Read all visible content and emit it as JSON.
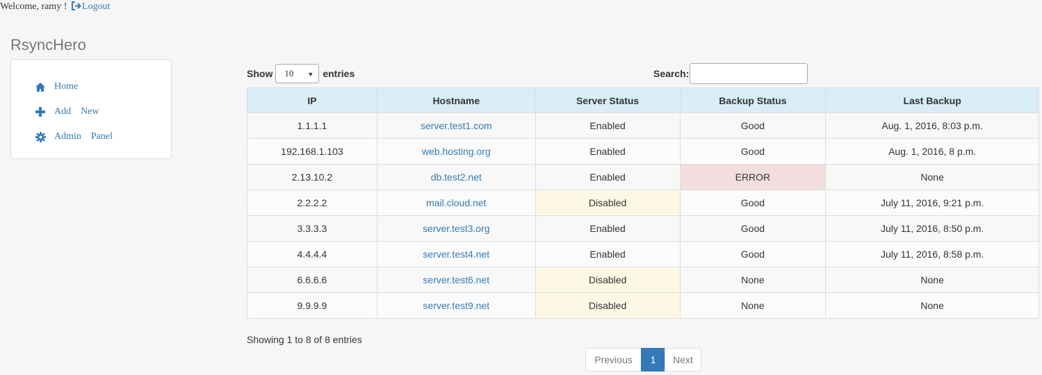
{
  "topbar": {
    "welcome": "Welcome, ramy !",
    "logout_label": "Logout"
  },
  "brand": "RsyncHero",
  "sidebar": {
    "items": [
      {
        "words": [
          "Home"
        ],
        "icon": "home-icon"
      },
      {
        "words": [
          "Add",
          "New"
        ],
        "icon": "plus-icon"
      },
      {
        "words": [
          "Admin",
          "Panel"
        ],
        "icon": "gear-icon"
      }
    ]
  },
  "controls": {
    "show_label": "Show",
    "page_size": "10",
    "entries_label": "entries",
    "search_label": "Search:",
    "search_value": ""
  },
  "table": {
    "headers": [
      "IP",
      "Hostname",
      "Server Status",
      "Backup Status",
      "Last Backup"
    ],
    "rows": [
      {
        "ip": "1.1.1.1",
        "hostname": "server.test1.com",
        "server_status": "Enabled",
        "backup_status": "Good",
        "last_backup": "Aug. 1, 2016, 8:03 p.m."
      },
      {
        "ip": "192.168.1.103",
        "hostname": "web.hosting.org",
        "server_status": "Enabled",
        "backup_status": "Good",
        "last_backup": "Aug. 1, 2016, 8 p.m."
      },
      {
        "ip": "2.13.10.2",
        "hostname": "db.test2.net",
        "server_status": "Enabled",
        "backup_status": "ERROR",
        "last_backup": "None"
      },
      {
        "ip": "2.2.2.2",
        "hostname": "mail.cloud.net",
        "server_status": "Disabled",
        "backup_status": "Good",
        "last_backup": "July 11, 2016, 9:21 p.m."
      },
      {
        "ip": "3.3.3.3",
        "hostname": "server.test3.org",
        "server_status": "Enabled",
        "backup_status": "Good",
        "last_backup": "July 11, 2016, 8:50 p.m."
      },
      {
        "ip": "4.4.4.4",
        "hostname": "server.test4.net",
        "server_status": "Enabled",
        "backup_status": "Good",
        "last_backup": "July 11, 2016, 8:58 p.m."
      },
      {
        "ip": "6.6.6.6",
        "hostname": "server.test6.net",
        "server_status": "Disabled",
        "backup_status": "None",
        "last_backup": "None"
      },
      {
        "ip": "9.9.9.9",
        "hostname": "server.test9.net",
        "server_status": "Disabled",
        "backup_status": "None",
        "last_backup": "None"
      }
    ]
  },
  "footer": {
    "info": "Showing 1 to 8 of 8 entries",
    "prev_label": "Previous",
    "current_page": "1",
    "next_label": "Next"
  },
  "colors": {
    "link": "#337ab7",
    "header_bg": "#d9edf7",
    "warning_bg": "#fcf8e3",
    "error_bg": "#f2dede"
  }
}
